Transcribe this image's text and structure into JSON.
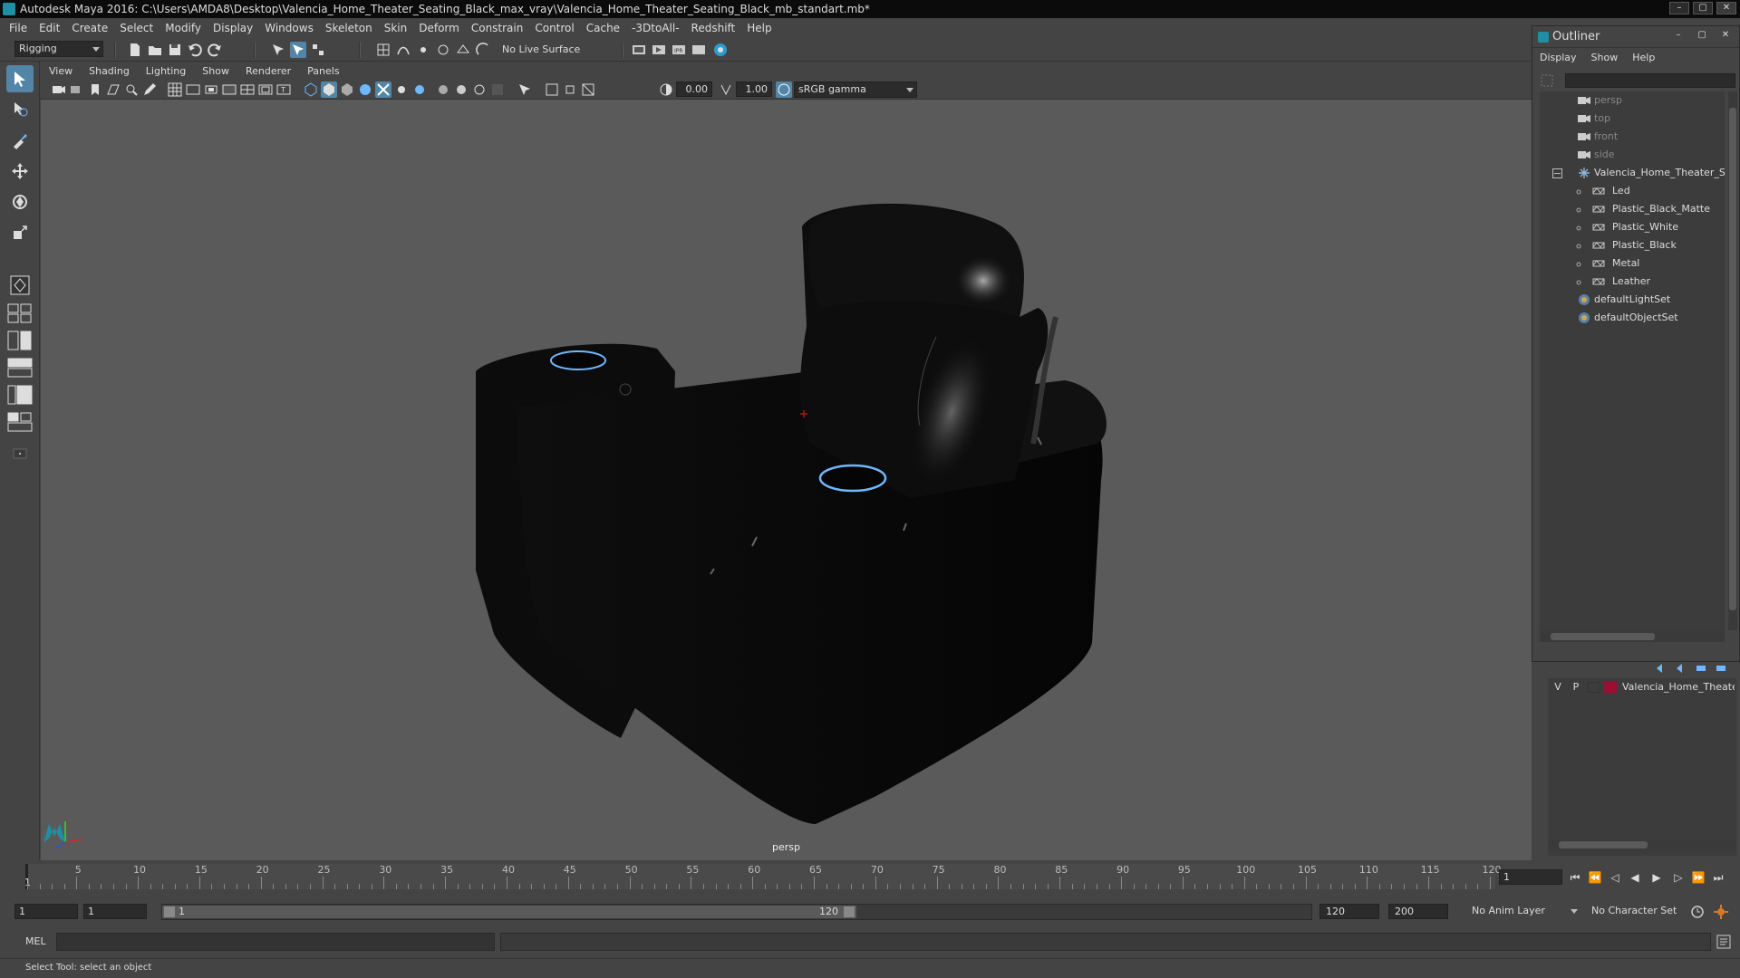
{
  "window": {
    "title": "Autodesk Maya 2016: C:\\Users\\AMDA8\\Desktop\\Valencia_Home_Theater_Seating_Black_max_vray\\Valencia_Home_Theater_Seating_Black_mb_standart.mb*",
    "controls": [
      "–",
      "▢",
      "✕"
    ]
  },
  "menubar": [
    "File",
    "Edit",
    "Create",
    "Select",
    "Modify",
    "Display",
    "Windows",
    "Skeleton",
    "Skin",
    "Deform",
    "Constrain",
    "Control",
    "Cache",
    "-3DtoAll-",
    "Redshift",
    "Help"
  ],
  "statusline": {
    "menuset": "Rigging",
    "live_surface": "No Live Surface"
  },
  "viewport": {
    "menus": [
      "View",
      "Shading",
      "Lighting",
      "Show",
      "Renderer",
      "Panels"
    ],
    "exposure": "0.00",
    "gamma": "1.00",
    "color_space": "sRGB gamma",
    "camera_label": "persp"
  },
  "outliner": {
    "title": "Outliner",
    "menus": [
      "Display",
      "Show",
      "Help"
    ],
    "items": [
      {
        "label": "persp",
        "type": "camera",
        "dim": true
      },
      {
        "label": "top",
        "type": "camera",
        "dim": true
      },
      {
        "label": "front",
        "type": "camera",
        "dim": true
      },
      {
        "label": "side",
        "type": "camera",
        "dim": true
      },
      {
        "label": "Valencia_Home_Theater_Seating_Black",
        "type": "group",
        "dim": false
      },
      {
        "label": "Led",
        "type": "mesh",
        "dim": false
      },
      {
        "label": "Plastic_Black_Matte",
        "type": "mesh",
        "dim": false
      },
      {
        "label": "Plastic_White",
        "type": "mesh",
        "dim": false
      },
      {
        "label": "Plastic_Black",
        "type": "mesh",
        "dim": false
      },
      {
        "label": "Metal",
        "type": "mesh",
        "dim": false
      },
      {
        "label": "Leather",
        "type": "mesh",
        "dim": false
      },
      {
        "label": "defaultLightSet",
        "type": "set",
        "dim": false
      },
      {
        "label": "defaultObjectSet",
        "type": "set",
        "dim": false
      }
    ]
  },
  "layers": {
    "row": {
      "v": "V",
      "p": "P",
      "name": "Valencia_Home_Theater_Seating_Black",
      "color": "#9b1030"
    }
  },
  "timeline": {
    "ticks": [
      "5",
      "10",
      "15",
      "20",
      "25",
      "30",
      "35",
      "40",
      "45",
      "50",
      "55",
      "60",
      "65",
      "70",
      "75",
      "80",
      "85",
      "90",
      "95",
      "100",
      "105",
      "110",
      "115",
      "120"
    ],
    "current_frame": "1",
    "current_frame_field": "1"
  },
  "range": {
    "start": "1",
    "start2": "1",
    "slider_start": "1",
    "slider_end": "120",
    "end": "120",
    "end2": "200",
    "anim_layer": "No Anim Layer",
    "character_set": "No Character Set"
  },
  "command": {
    "label": "MEL"
  },
  "help_line": "Select Tool: select an object",
  "colors": {
    "accent": "#5285a6",
    "maya_teal": "#1e8fa5",
    "viewport_bg": "#5a5a5a",
    "led_blue": "#6fb7ff"
  }
}
